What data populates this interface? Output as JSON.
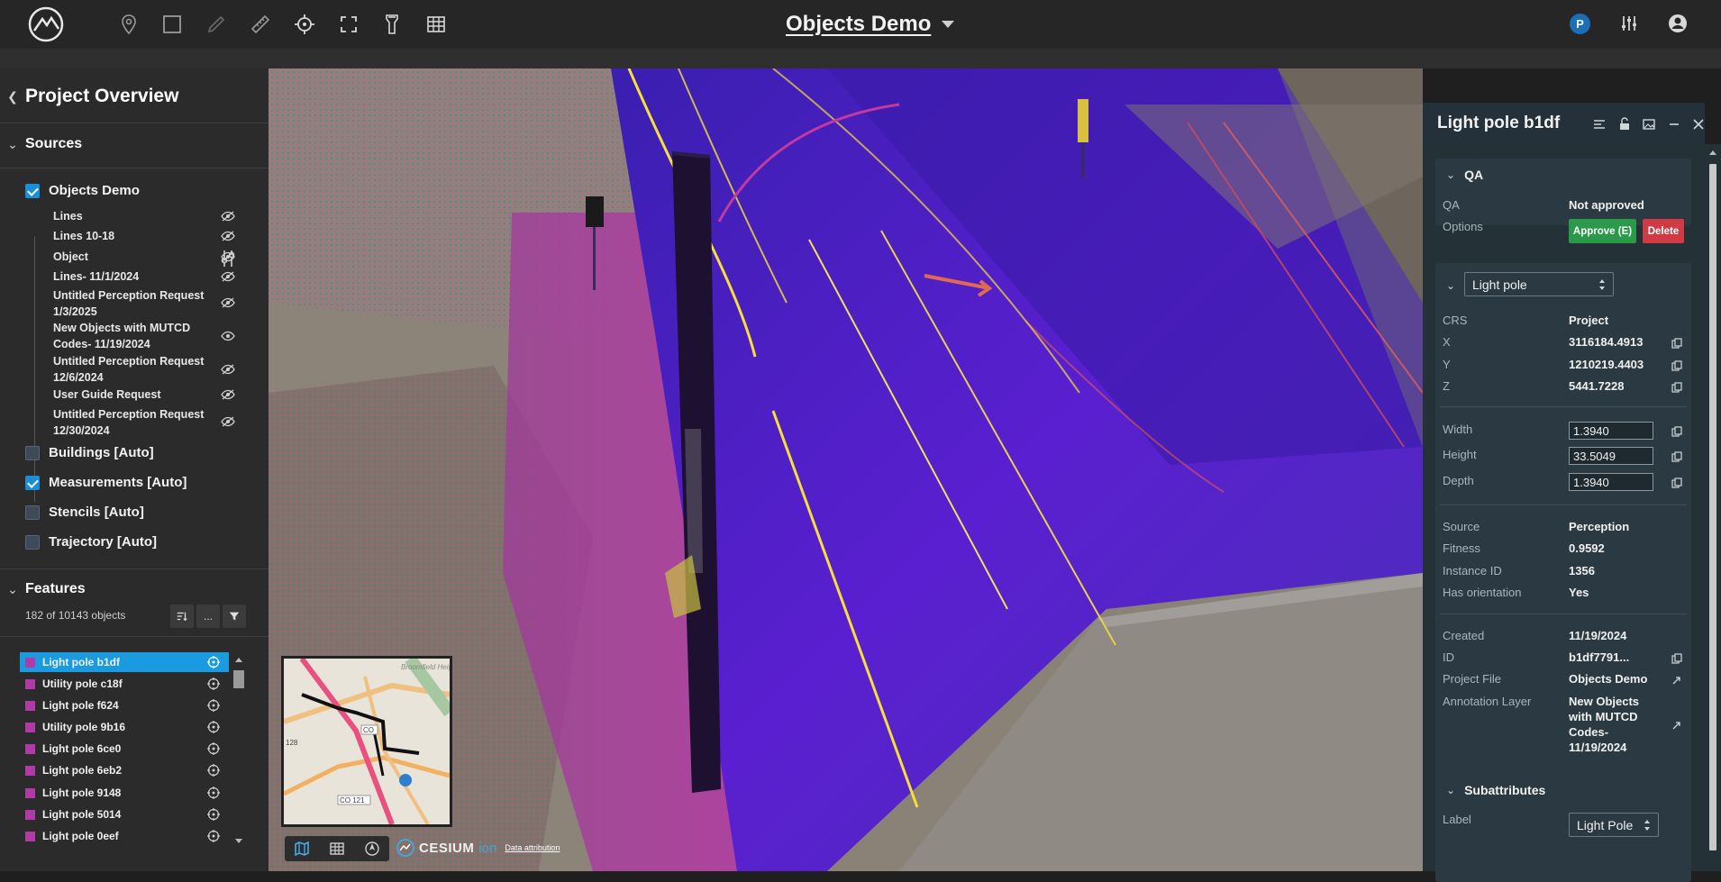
{
  "app": {
    "title": "Objects Demo",
    "user_initial": "P"
  },
  "toolbar": {
    "tools": [
      "location-pin-icon",
      "rectangle-select-icon",
      "pen-icon",
      "ruler-icon",
      "crosshair-icon",
      "fullscreen-icon",
      "flashlight-icon",
      "grid-icon"
    ],
    "right": [
      "user-avatar",
      "settings-sliders-icon",
      "account-icon"
    ]
  },
  "left_panel": {
    "title": "Project Overview",
    "sources_title": "Sources",
    "source_project": "Objects Demo",
    "layers": [
      "Lines",
      "Lines 10-18",
      "Object",
      "Lines- 11/1/2024",
      "Untitled Perception Request 1/3/2025",
      "New Objects with MUTCD Codes- 11/19/2024",
      "Untitled Perception Request 12/6/2024",
      "User Guide Request",
      "Untitled Perception Request 12/30/2024"
    ],
    "auto_sources": [
      {
        "label": "Buildings [Auto]",
        "checked": false
      },
      {
        "label": "Measurements [Auto]",
        "checked": true
      },
      {
        "label": "Stencils [Auto]",
        "checked": false
      },
      {
        "label": "Trajectory [Auto]",
        "checked": false
      }
    ],
    "features_title": "Features",
    "features_count": "182 of 10143 objects",
    "feature_more": "...",
    "features": [
      "Light pole b1df",
      "Utility pole c18f",
      "Light pole f624",
      "Utility pole 9b16",
      "Light pole 6ce0",
      "Light pole 6eb2",
      "Light pole 9148",
      "Light pole 5014",
      "Light pole 0eef"
    ],
    "feature_color": "#b03aa8",
    "selected_index": 0
  },
  "viewport": {
    "minimap_labels": [
      "CO",
      "128",
      "CO 121",
      "Broomfield Heights"
    ],
    "cesium": "CESIUM",
    "cesium_ion": "ion",
    "attribution": "Data attribution"
  },
  "details": {
    "title": "Light pole b1df",
    "qa_section": "QA",
    "qa_label": "QA",
    "qa_value": "Not approved",
    "options_label": "Options",
    "approve_label": "Approve (E)",
    "delete_label": "Delete",
    "class_select": "Light pole",
    "crs_label": "CRS",
    "crs_value": "Project",
    "x_label": "X",
    "x_value": "3116184.4913",
    "y_label": "Y",
    "y_value": "1210219.4403",
    "z_label": "Z",
    "z_value": "5441.7228",
    "width_label": "Width",
    "width_value": "1.3940",
    "height_label": "Height",
    "height_value": "33.5049",
    "depth_label": "Depth",
    "depth_value": "1.3940",
    "source_label": "Source",
    "source_value": "Perception",
    "fitness_label": "Fitness",
    "fitness_value": "0.9592",
    "instance_label": "Instance ID",
    "instance_value": "1356",
    "orientation_label": "Has orientation",
    "orientation_value": "Yes",
    "created_label": "Created",
    "created_value": "11/19/2024",
    "id_label": "ID",
    "id_value": "b1df7791...",
    "project_file_label": "Project File",
    "project_file_value": "Objects Demo",
    "annotation_label": "Annotation Layer",
    "annotation_value_1": "New Objects",
    "annotation_value_2": "with MUTCD",
    "annotation_value_3": "Codes-",
    "annotation_value_4": "11/19/2024",
    "subattributes_section": "Subattributes",
    "label_label": "Label",
    "label_value": "Light Pole"
  },
  "colors": {
    "accent": "#1a9be0",
    "approve": "#2a9a4a",
    "delete": "#d03a45",
    "point_cloud_purple": "#5a1fd0",
    "point_cloud_magenta": "#c02ab0",
    "lane_yellow": "#f5e03a"
  }
}
